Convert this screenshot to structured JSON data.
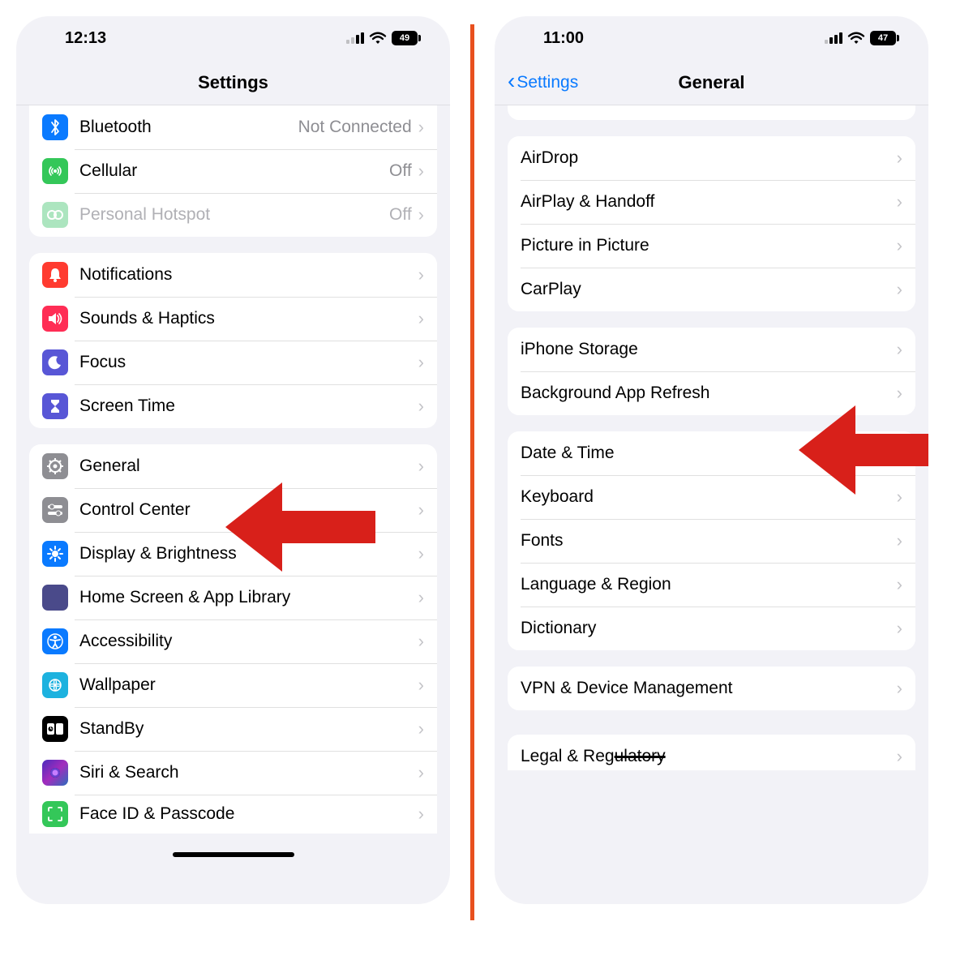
{
  "left": {
    "status": {
      "time": "12:13",
      "battery": "49"
    },
    "nav": {
      "title": "Settings"
    },
    "group1": [
      {
        "icon": "bluetooth",
        "label": "Bluetooth",
        "value": "Not Connected"
      },
      {
        "icon": "cellular",
        "label": "Cellular",
        "value": "Off"
      },
      {
        "icon": "hotspot",
        "label": "Personal Hotspot",
        "value": "Off",
        "dim": true
      }
    ],
    "group2": [
      {
        "icon": "notifications",
        "label": "Notifications"
      },
      {
        "icon": "sounds",
        "label": "Sounds & Haptics"
      },
      {
        "icon": "focus",
        "label": "Focus"
      },
      {
        "icon": "screentime",
        "label": "Screen Time"
      }
    ],
    "group3": [
      {
        "icon": "general",
        "label": "General"
      },
      {
        "icon": "controlcenter",
        "label": "Control Center"
      },
      {
        "icon": "display",
        "label": "Display & Brightness"
      },
      {
        "icon": "homescreen",
        "label": "Home Screen & App Library"
      },
      {
        "icon": "accessibility",
        "label": "Accessibility"
      },
      {
        "icon": "wallpaper",
        "label": "Wallpaper"
      },
      {
        "icon": "standby",
        "label": "StandBy"
      },
      {
        "icon": "siri",
        "label": "Siri & Search"
      },
      {
        "icon": "faceid",
        "label": "Face ID & Passcode"
      }
    ]
  },
  "right": {
    "status": {
      "time": "11:00",
      "battery": "47"
    },
    "nav": {
      "back": "Settings",
      "title": "General"
    },
    "group1": [
      {
        "label": "AirDrop"
      },
      {
        "label": "AirPlay & Handoff"
      },
      {
        "label": "Picture in Picture"
      },
      {
        "label": "CarPlay"
      }
    ],
    "group2": [
      {
        "label": "iPhone Storage"
      },
      {
        "label": "Background App Refresh"
      }
    ],
    "group3": [
      {
        "label": "Date & Time"
      },
      {
        "label": "Keyboard"
      },
      {
        "label": "Fonts"
      },
      {
        "label": "Language & Region"
      },
      {
        "label": "Dictionary"
      }
    ],
    "group4": [
      {
        "label": "VPN & Device Management"
      }
    ],
    "group5": [
      {
        "label": "Legal & Regulatory"
      }
    ]
  }
}
